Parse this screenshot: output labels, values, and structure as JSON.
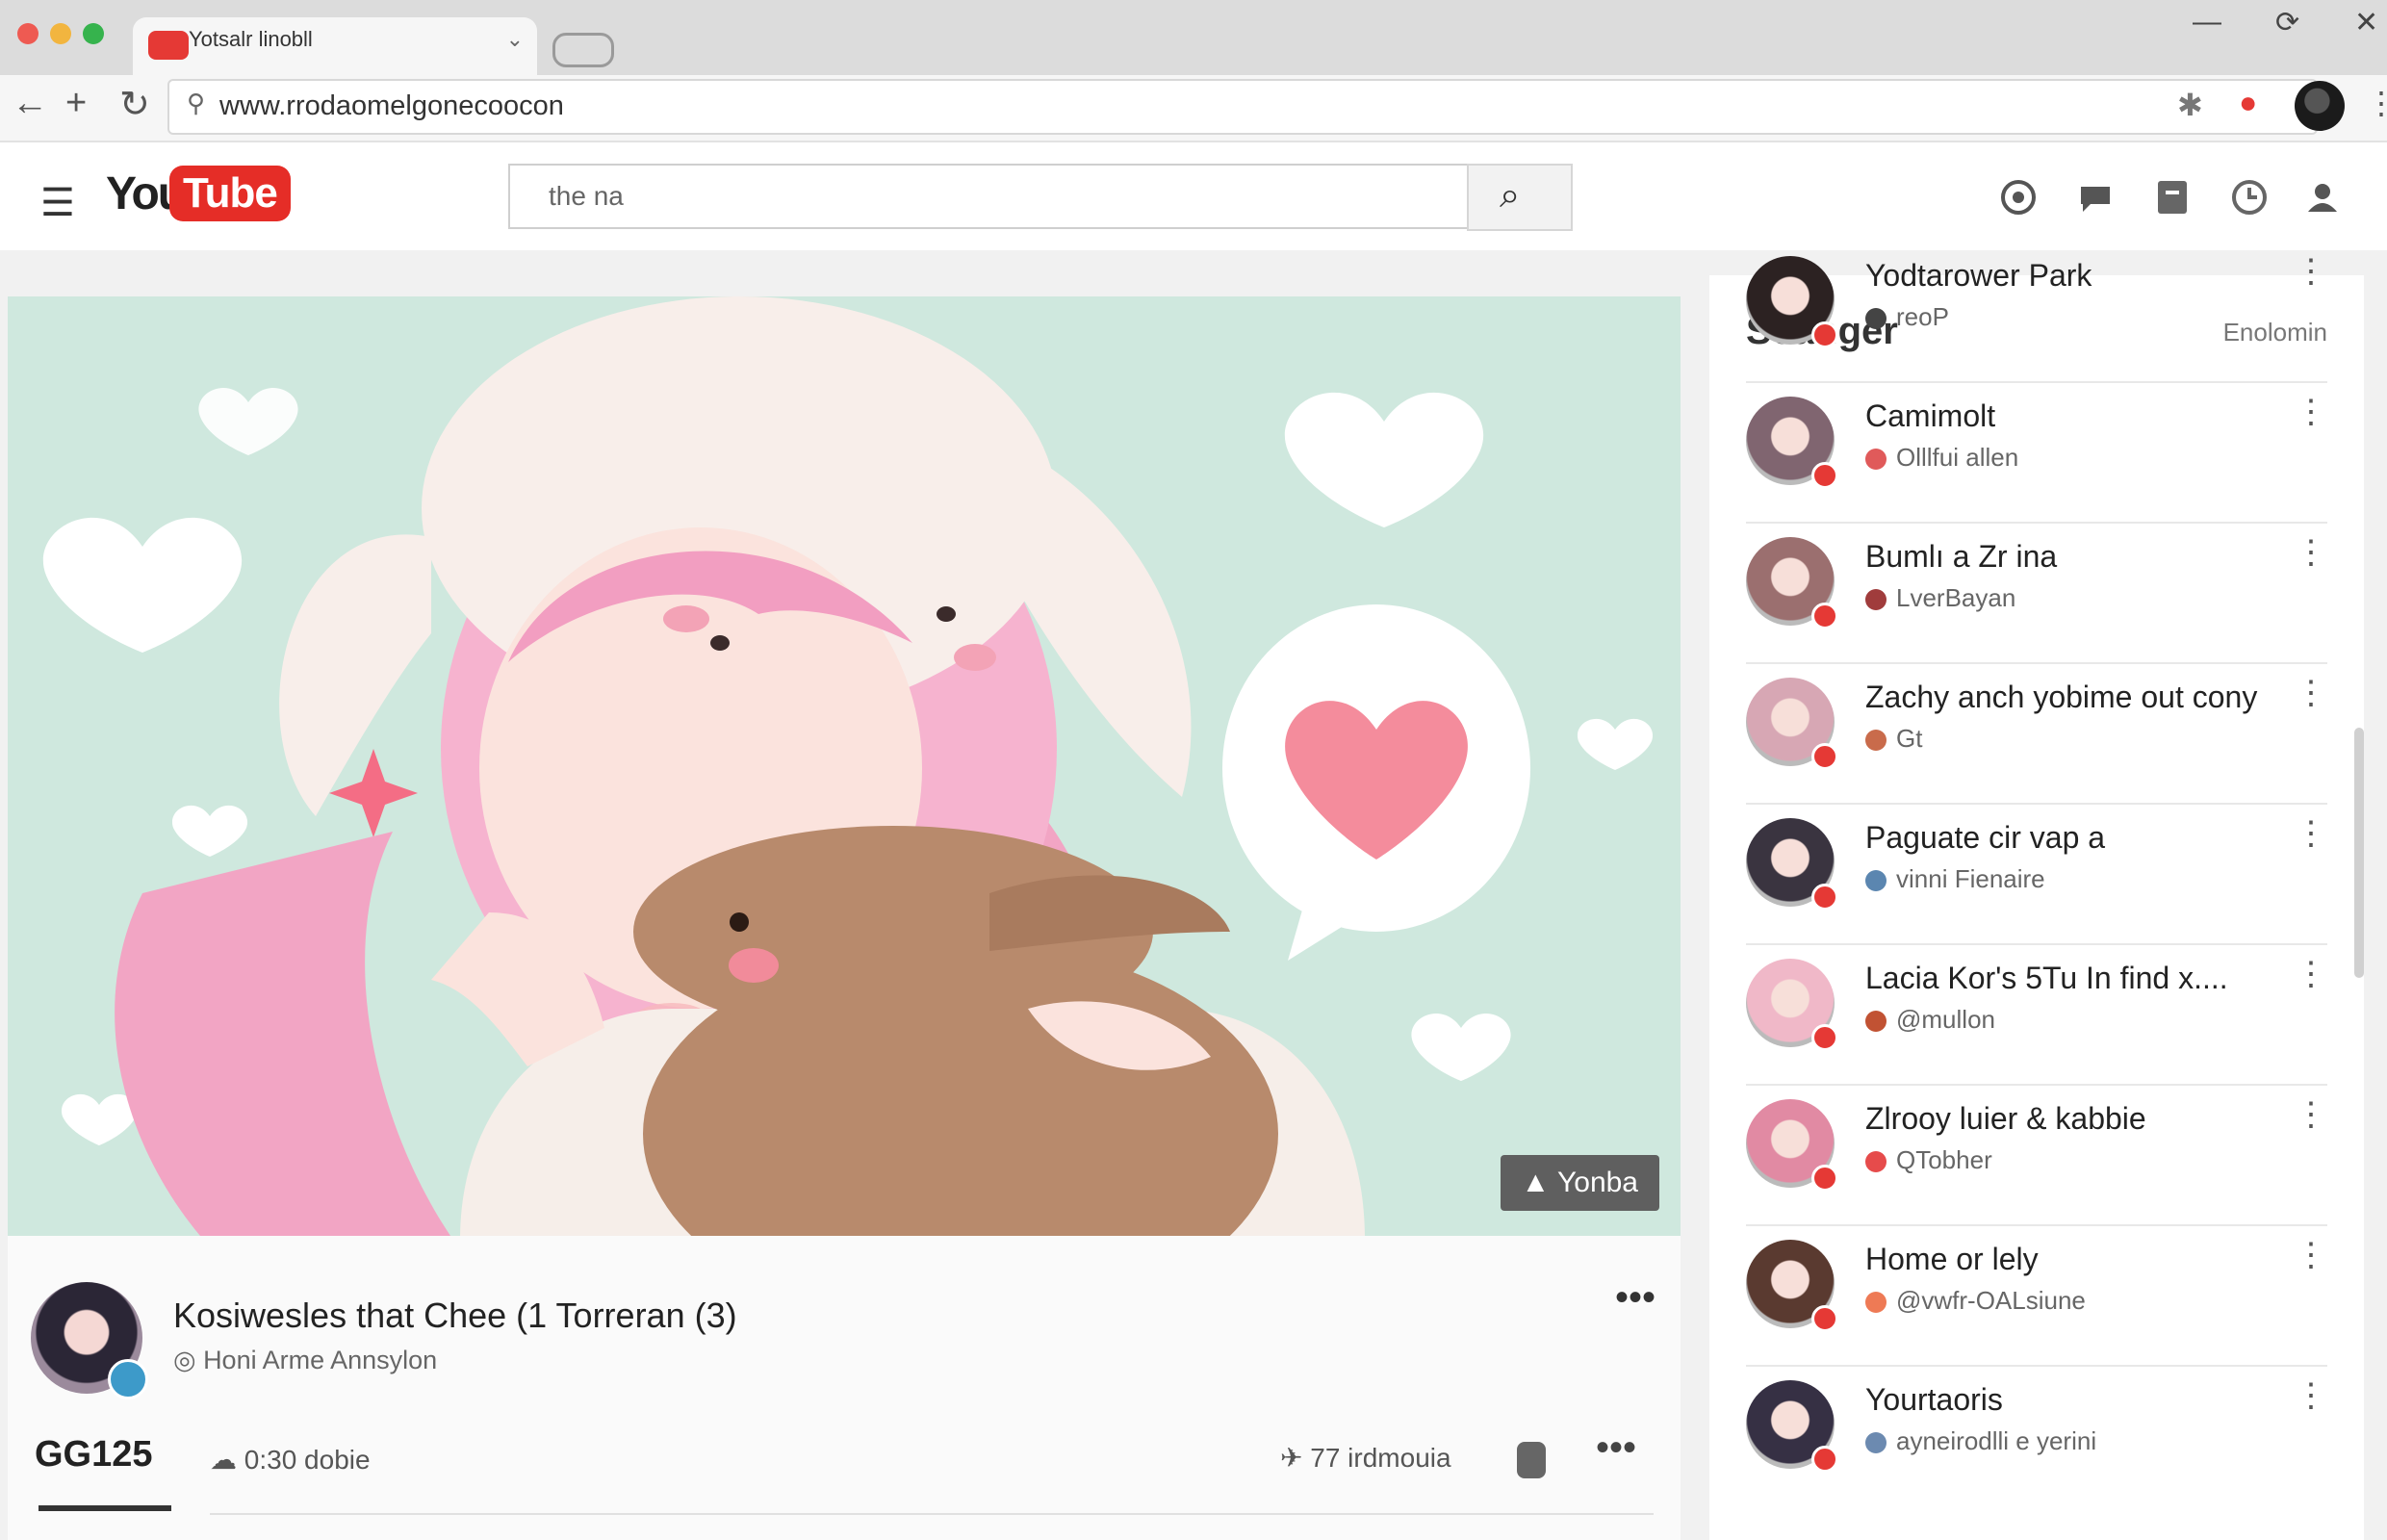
{
  "browser": {
    "tab_title": "Yotsalr linobll",
    "url": "www.rrodaomelgonecoocon"
  },
  "header": {
    "logo_you": "You",
    "logo_tube": "Tube",
    "search_value": "the na"
  },
  "video": {
    "overlay_label": "Yonba",
    "title": "Kosiwesles that Chee (1 Torreran (3)",
    "channel": "Honi Arme Annsylon",
    "stat_big": "GG125",
    "stat_line": "0:30 dobie",
    "rating": "77 irdmouia"
  },
  "sidebar": {
    "heading": "Seanger",
    "link": "Enolomin",
    "items": [
      {
        "title": "Yodtarower Park",
        "sub": "reoP",
        "thumb": "#2c2222",
        "sub_color": "#444"
      },
      {
        "title": "Camimolt",
        "sub": "Olllfui allen",
        "thumb": "#806570",
        "sub_color": "#e05a5a"
      },
      {
        "title": "Bumlı a Zr ina",
        "sub": "LverBayan",
        "thumb": "#9b6f6f",
        "sub_color": "#a03c3c"
      },
      {
        "title": "Zachy anch yobime out cony",
        "sub": "Gt",
        "thumb": "#d7a7b4",
        "sub_color": "#c96b4b"
      },
      {
        "title": "Paguate cir vap a",
        "sub": "vinni Fienaire",
        "thumb": "#3a3440",
        "sub_color": "#5b86b0"
      },
      {
        "title": "Lacia Kor's 5Tu In find x....",
        "sub": "@mullon",
        "thumb": "#f0b8c8",
        "sub_color": "#c15233"
      },
      {
        "title": "Zlrooy luier & kabbie",
        "sub": "QTobher",
        "thumb": "#e18aa3",
        "sub_color": "#e64b4b"
      },
      {
        "title": "Home or lely",
        "sub": "@vwfr-OALsiune",
        "thumb": "#5a3a30",
        "sub_color": "#ee7a55"
      },
      {
        "title": "Yourtaoris",
        "sub": "ayneirodlli e yerini",
        "thumb": "#363044",
        "sub_color": "#6c8ab0"
      }
    ]
  }
}
